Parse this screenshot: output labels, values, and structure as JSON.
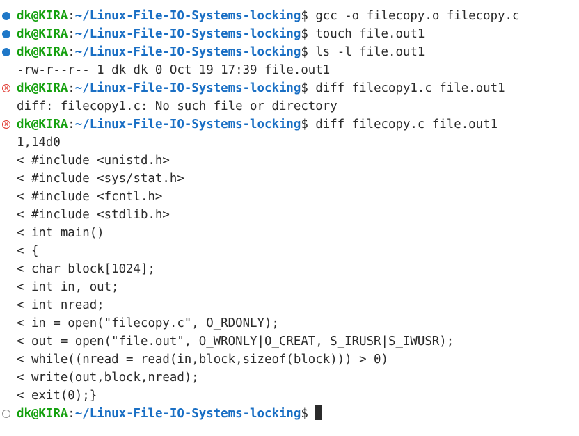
{
  "colors": {
    "user": "#14a00e",
    "path": "#1a6fc4",
    "text": "#2b2b2b",
    "decoration_success": "#1f78c8",
    "decoration_error": "#e0342b",
    "decoration_pending": "#8a8a8a",
    "background": "#ffffff"
  },
  "prompt": {
    "user": "dk@KIRA",
    "separator": ":",
    "path": "~/Linux-File-IO-Systems-locking",
    "symbol": "$"
  },
  "lines": [
    {
      "kind": "prompt",
      "deco": "success",
      "cmd": "gcc -o filecopy.o filecopy.c"
    },
    {
      "kind": "prompt",
      "deco": "success",
      "cmd": "touch file.out1"
    },
    {
      "kind": "prompt",
      "deco": "success",
      "cmd": "ls -l file.out1"
    },
    {
      "kind": "output",
      "text": "-rw-r--r-- 1 dk dk 0 Oct 19 17:39 file.out1"
    },
    {
      "kind": "prompt",
      "deco": "error",
      "cmd": "diff filecopy1.c file.out1"
    },
    {
      "kind": "output",
      "text": "diff: filecopy1.c: No such file or directory"
    },
    {
      "kind": "prompt",
      "deco": "error",
      "cmd": "diff filecopy.c file.out1"
    },
    {
      "kind": "output",
      "text": "1,14d0"
    },
    {
      "kind": "output",
      "text": "< #include <unistd.h>"
    },
    {
      "kind": "output",
      "text": "< #include <sys/stat.h>"
    },
    {
      "kind": "output",
      "text": "< #include <fcntl.h>"
    },
    {
      "kind": "output",
      "text": "< #include <stdlib.h>"
    },
    {
      "kind": "output",
      "text": "< int main()"
    },
    {
      "kind": "output",
      "text": "< {"
    },
    {
      "kind": "output",
      "text": "< char block[1024];"
    },
    {
      "kind": "output",
      "text": "< int in, out;"
    },
    {
      "kind": "output",
      "text": "< int nread;"
    },
    {
      "kind": "output",
      "text": "< in = open(\"filecopy.c\", O_RDONLY);"
    },
    {
      "kind": "output",
      "text": "< out = open(\"file.out\", O_WRONLY|O_CREAT, S_IRUSR|S_IWUSR);"
    },
    {
      "kind": "output",
      "text": "< while((nread = read(in,block,sizeof(block))) > 0)"
    },
    {
      "kind": "output",
      "text": "< write(out,block,nread);"
    },
    {
      "kind": "output",
      "text": "< exit(0);}"
    },
    {
      "kind": "prompt",
      "deco": "pending",
      "cmd": "",
      "cursor": true
    }
  ]
}
